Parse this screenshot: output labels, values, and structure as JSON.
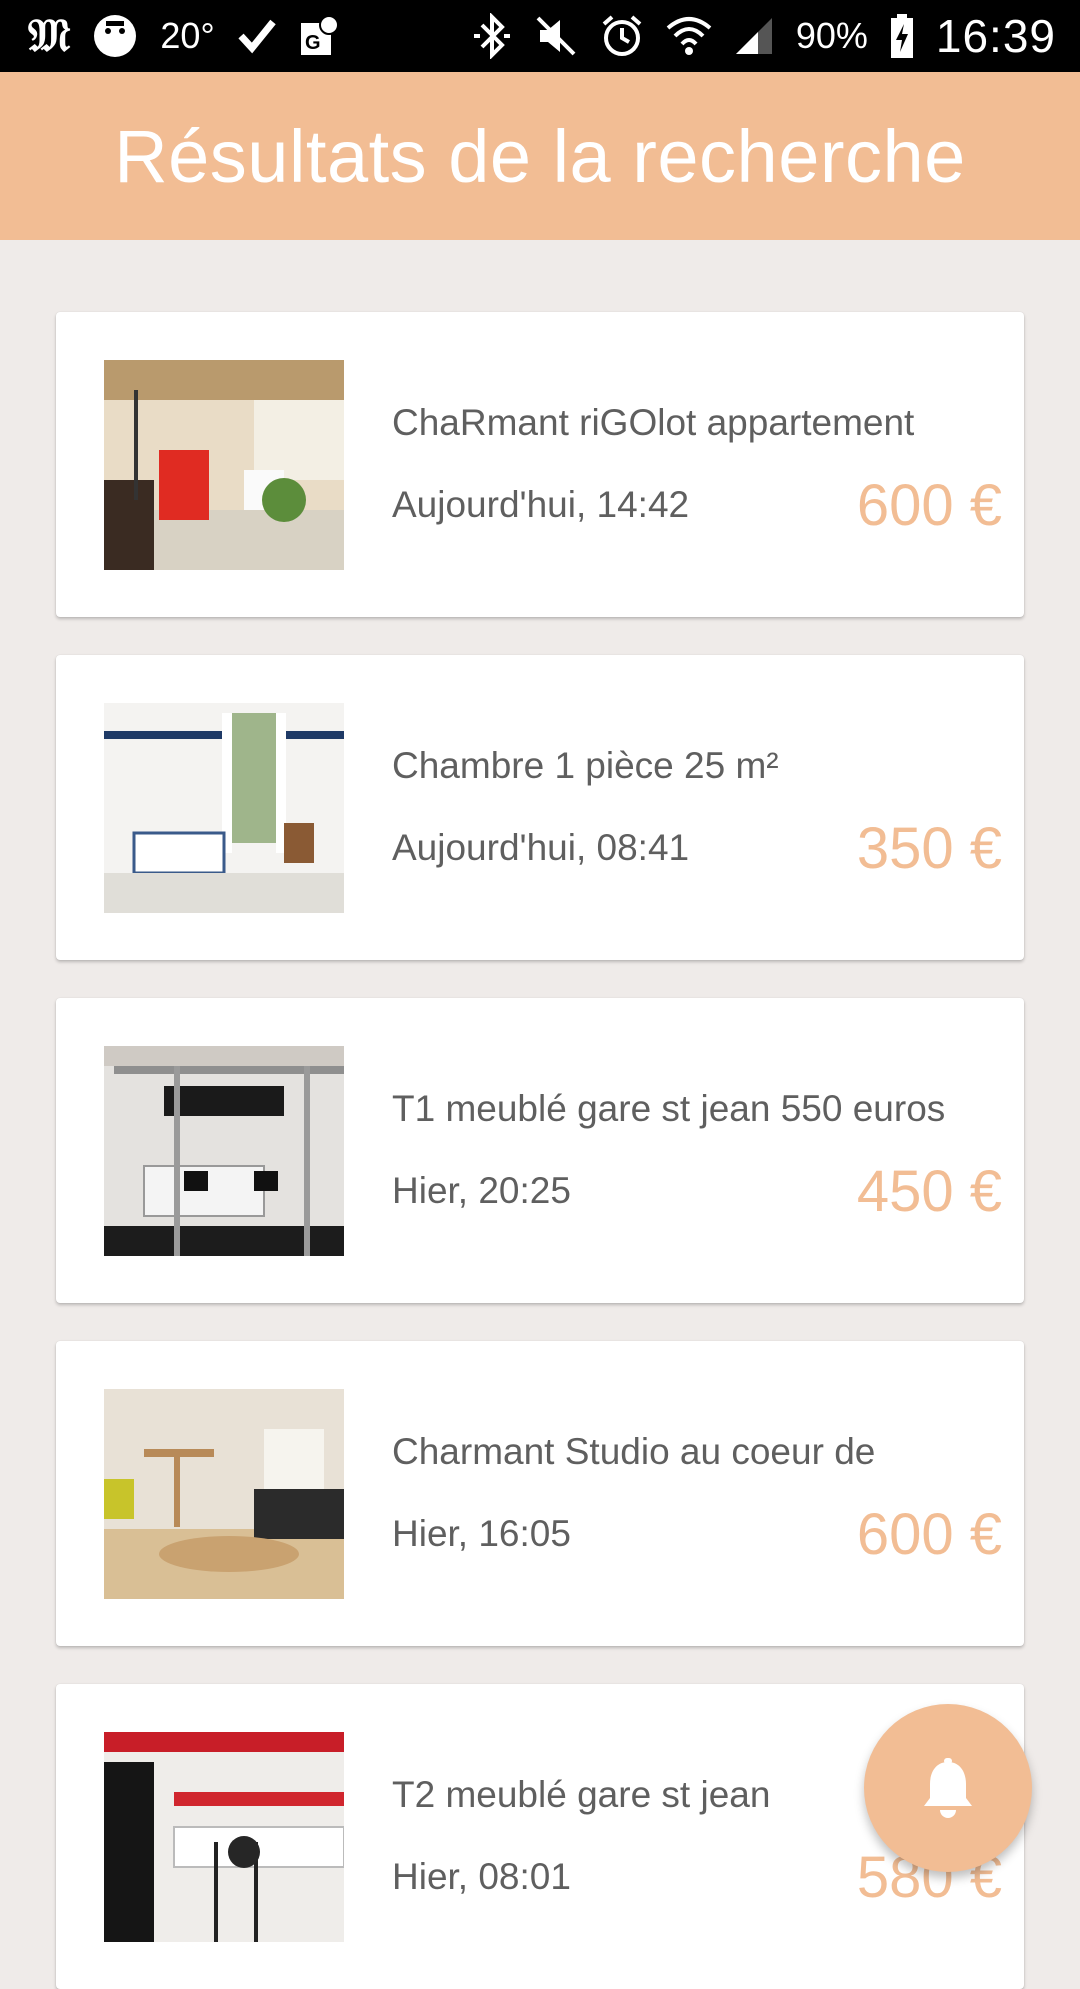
{
  "status_bar": {
    "logo": "𝔐",
    "temperature": "20°",
    "battery": "90%",
    "time": "16:39"
  },
  "header": {
    "title": "Résultats de la recherche"
  },
  "listings": [
    {
      "title": "ChaRmant riGOlot appartement",
      "date": "Aujourd'hui, 14:42",
      "price": "600 €"
    },
    {
      "title": "Chambre 1 pièce 25 m²",
      "date": "Aujourd'hui, 08:41",
      "price": "350 €"
    },
    {
      "title": "T1 meublé gare st jean 550 euros",
      "date": "Hier, 20:25",
      "price": "450 €"
    },
    {
      "title": "Charmant Studio au coeur de",
      "date": "Hier, 16:05",
      "price": "600 €"
    },
    {
      "title": "T2 meublé gare st jean",
      "date": "Hier, 08:01",
      "price": "580 €"
    }
  ],
  "fab": {
    "icon": "bell-icon"
  },
  "colors": {
    "accent": "#f2bd94",
    "background": "#efebe9",
    "text": "#5f5f5f"
  }
}
